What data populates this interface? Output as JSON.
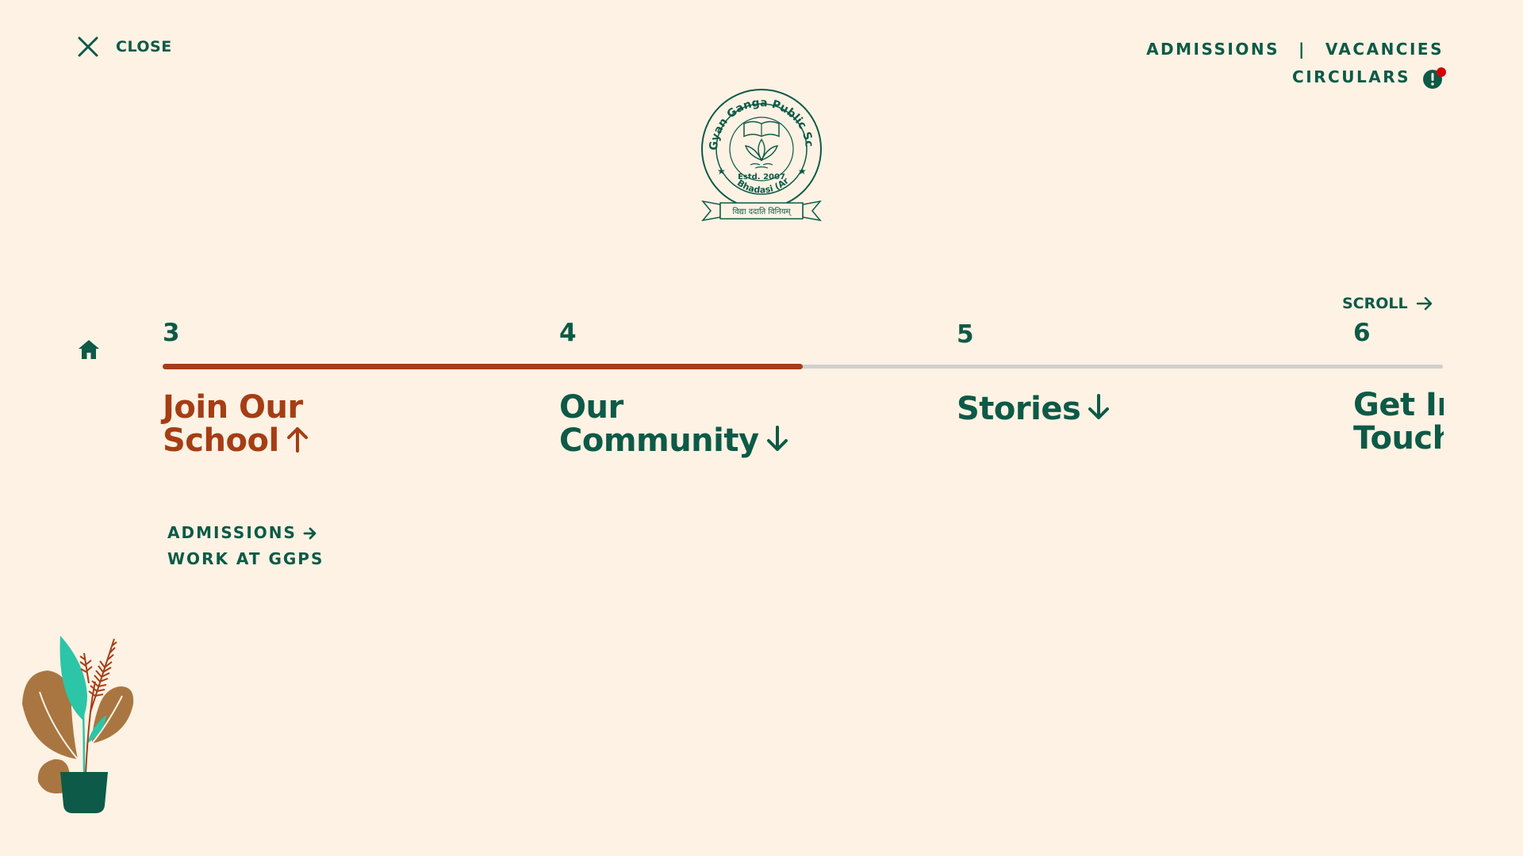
{
  "colors": {
    "background": "#fdf2e4",
    "primary": "#0c5a47",
    "accent": "#a63d14",
    "track": "#cfcfcf",
    "alert_dot": "#d60000"
  },
  "header": {
    "close_label": "CLOSE",
    "close_icon": "close-icon",
    "nav": {
      "admissions": "ADMISSIONS",
      "separator": "|",
      "vacancies": "VACANCIES",
      "circulars": "CIRCULARS"
    },
    "circulars_icon": "alert-icon"
  },
  "logo": {
    "text": "Gyan Ganga Public School",
    "estd": "Estd. 2007",
    "place": "Bhadasi (Arwal)",
    "motto": "विद्या ददाति विनियम्"
  },
  "timeline": {
    "home_icon": "home-icon",
    "scroll_label": "SCROLL",
    "progress": 0.5,
    "sections": [
      {
        "number": "3",
        "line1": "Join Our",
        "line2": "School",
        "arrow": "up",
        "active": true
      },
      {
        "number": "4",
        "line1": "Our",
        "line2": "Community",
        "arrow": "down",
        "active": false
      },
      {
        "number": "5",
        "line1": "Stories",
        "line2": "",
        "arrow": "down",
        "active": false
      },
      {
        "number": "6",
        "line1": "Get In",
        "line2": "Touch",
        "arrow": "none",
        "active": false
      }
    ]
  },
  "sublinks": [
    {
      "label": "ADMISSIONS",
      "icon": "arrow-right-icon"
    },
    {
      "label": "WORK AT GGPS"
    }
  ],
  "decoration": {
    "icon": "plant-illustration"
  }
}
